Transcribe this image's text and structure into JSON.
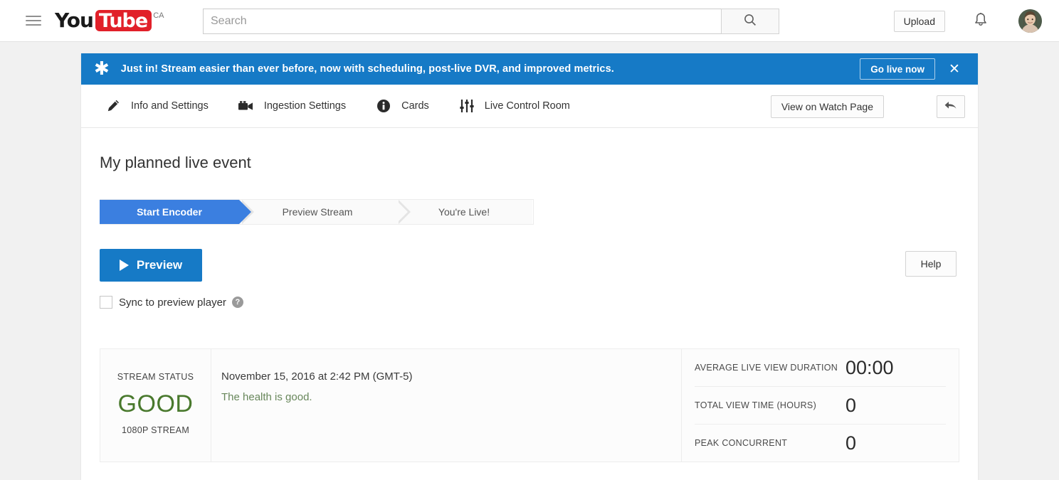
{
  "masthead": {
    "guide_icon": "hamburger-menu-icon",
    "logo": {
      "part1": "You",
      "part2": "Tube",
      "country": "CA"
    },
    "search": {
      "value": "",
      "placeholder": "Search",
      "icon": "search-icon"
    },
    "upload_label": "Upload",
    "notifications_icon": "bell-icon",
    "avatar_icon": "user-avatar"
  },
  "promo": {
    "icon": "star-icon",
    "message": "Just in! Stream easier than ever before, now with scheduling, post-live DVR, and improved metrics.",
    "cta_label": "Go live now",
    "close_icon": "close-icon",
    "background": "#167ac6"
  },
  "tabnav": {
    "tabs": [
      {
        "label": "Info and Settings",
        "icon": "pencil-icon"
      },
      {
        "label": "Ingestion Settings",
        "icon": "video-camera-icon"
      },
      {
        "label": "Cards",
        "icon": "info-circle-icon"
      },
      {
        "label": "Live Control Room",
        "icon": "sliders-icon"
      }
    ],
    "watch_page_label": "View on Watch Page",
    "back_icon": "back-arrow-icon"
  },
  "main": {
    "title": "My planned live event",
    "steps": [
      {
        "label": "Start Encoder",
        "active": true
      },
      {
        "label": "Preview Stream",
        "active": false
      },
      {
        "label": "You're Live!",
        "active": false
      }
    ],
    "preview_button": {
      "label": "Preview",
      "icon": "play-icon"
    },
    "help_button": "Help",
    "sync_checkbox": {
      "label": "Sync to preview player",
      "checked": false,
      "help_icon": "question-mark-icon"
    }
  },
  "status_panel": {
    "caption": "STREAM STATUS",
    "value": "GOOD",
    "resolution": "1080P STREAM",
    "value_color": "#49792d",
    "timestamp": "November 15, 2016 at 2:42 PM (GMT-5)",
    "health_message": "The health is good.",
    "metrics": [
      {
        "label": "AVERAGE LIVE VIEW DURATION",
        "value": "00:00"
      },
      {
        "label": "TOTAL VIEW TIME (HOURS)",
        "value": "0"
      },
      {
        "label": "PEAK CONCURRENT",
        "value": "0"
      }
    ]
  }
}
